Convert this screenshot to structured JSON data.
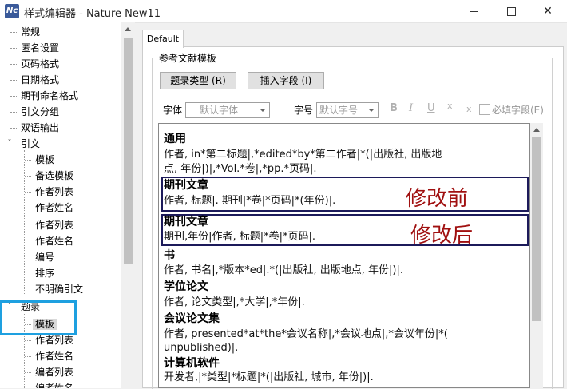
{
  "window": {
    "title": "样式编辑器 - Nature New11",
    "icon_text": "Nc"
  },
  "tree": {
    "items": [
      {
        "label": "常规",
        "indent": 1
      },
      {
        "label": "匿名设置",
        "indent": 1
      },
      {
        "label": "页码格式",
        "indent": 1
      },
      {
        "label": "日期格式",
        "indent": 1
      },
      {
        "label": "期刊命名格式",
        "indent": 1
      },
      {
        "label": "引文分组",
        "indent": 1
      },
      {
        "label": "双语输出",
        "indent": 1
      },
      {
        "label": "引文",
        "indent": 0,
        "expanded": true
      },
      {
        "label": "模板",
        "indent": 2
      },
      {
        "label": "备选模板",
        "indent": 2
      },
      {
        "label": "作者列表",
        "indent": 2
      },
      {
        "label": "作者姓名",
        "indent": 2
      },
      {
        "label": "作者列表",
        "indent": 2
      },
      {
        "label": "作者姓名",
        "indent": 2
      },
      {
        "label": "编号",
        "indent": 2
      },
      {
        "label": "排序",
        "indent": 2
      },
      {
        "label": "不明确引文",
        "indent": 2
      },
      {
        "label": "题录",
        "indent": 0,
        "expanded": true
      },
      {
        "label": "模板",
        "indent": 2,
        "selected": true
      },
      {
        "label": "作者列表",
        "indent": 2
      },
      {
        "label": "作者姓名",
        "indent": 2
      },
      {
        "label": "编者列表",
        "indent": 2
      },
      {
        "label": "编者姓名",
        "indent": 2
      }
    ]
  },
  "tab": {
    "label": "Default"
  },
  "group": {
    "label": "参考文献模板"
  },
  "buttons": {
    "type": "题录类型 (R)",
    "insert": "插入字段 (I)"
  },
  "font": {
    "label": "字体",
    "value": "默认字体",
    "size_label": "字号",
    "size_value": "默认字号"
  },
  "format": {
    "bold": "B",
    "italic": "I",
    "underline": "U",
    "superscript": "x",
    "subscript": "x"
  },
  "required": {
    "label": "必填字段(E)"
  },
  "editor": {
    "general_title": "通用",
    "general_l1": "作者, in*第二标题|,*edited*by*第二作者|*(|出版社, 出版地",
    "general_l2": "点, 年份|)|,*Vol.*卷|,*pp.*页码|.",
    "journal_before_title": "期刊文章",
    "journal_before_line": "作者, 标题|. 期刊|*卷|*页码|*(年份)|.",
    "journal_after_title": "期刊文章",
    "journal_after_line": "期刊,年份|作者, 标题|*卷|*页码|.",
    "book_title": "书",
    "book_line": "作者, 书名|,*版本*ed|.*(|出版社, 出版地点, 年份|)|.",
    "thesis_title": "学位论文",
    "thesis_line": "作者, 论文类型|,*大学|,*年份|.",
    "conf_title": "会议论文集",
    "conf_l1": "作者, presented*at*the*会议名称|,*会议地点|,*会议年份|*(",
    "conf_l2": "unpublished)|.",
    "software_title": "计算机软件",
    "software_line": "开发者,|*类型|*标题|*(|出版社, 城市, 年份|)|."
  },
  "annotations": {
    "before": "修改前",
    "after": "修改后"
  },
  "colors": {
    "annotation_text": "#a01010",
    "annotation_box": "#1c1a5a",
    "highlight": "#1ea0e0"
  }
}
